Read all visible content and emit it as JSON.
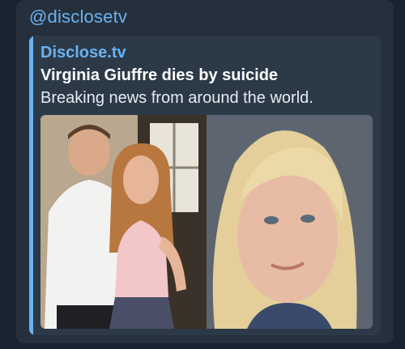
{
  "message": {
    "sender": "@disclosetv"
  },
  "link_preview": {
    "site_name": "Disclose.tv",
    "title": "Virginia Giuffre dies by suicide",
    "description": "Breaking news from around the world.",
    "image_icon": "photo-collage"
  },
  "colors": {
    "accent": "#6ab2f2",
    "bubble_bg": "#25303c",
    "preview_bg": "#2c3a48",
    "page_bg": "#1a2430"
  }
}
